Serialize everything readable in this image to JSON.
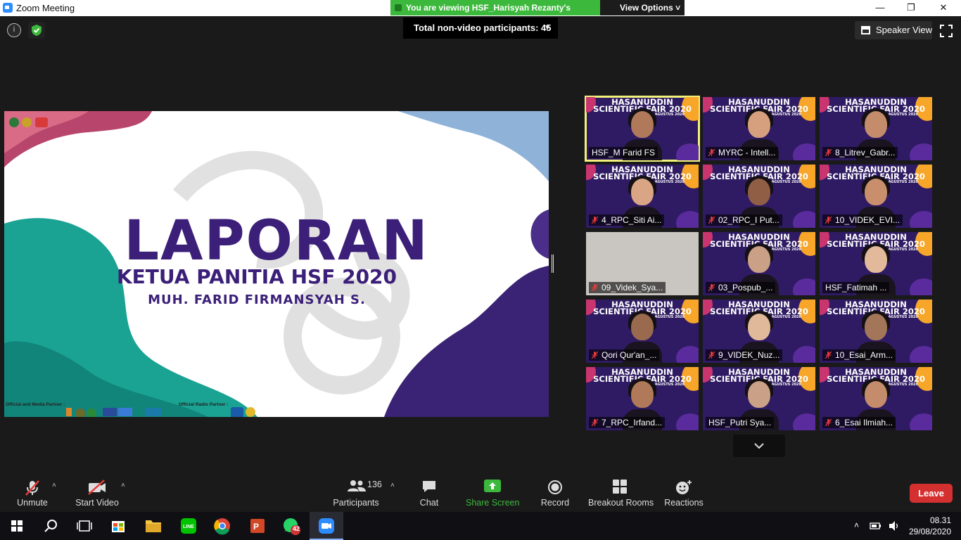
{
  "window": {
    "title": "Zoom Meeting",
    "minimize": "—",
    "maximize": "❒",
    "close": "✕"
  },
  "banner": {
    "viewing_text": "You are viewing HSF_Harisyah Rezanty's screen",
    "view_options": "View Options ˅"
  },
  "header": {
    "info_icon": "i",
    "nonvideo_participants": "Total non-video participants: 45",
    "nonvideo_chevron": "˅",
    "speaker_view": "Speaker View"
  },
  "slide": {
    "title": "LAPORAN",
    "subtitle": "KETUA PANITIA HSF 2020",
    "name": "MUH. FARID FIRMANSYAH S.",
    "media_partner_label": "Official and Media Partner :",
    "radio_partner_label": "Official Radio Partner :"
  },
  "tile_banner": {
    "line1": "HASANUDDIN",
    "line2": "SCIENTIFIC FAIR 2020",
    "date": "29 AGUSTUS 2020"
  },
  "participants": [
    {
      "name": "HSF_M Farid FS",
      "muted": false,
      "active": true
    },
    {
      "name": "MYRC - Intell...",
      "muted": true,
      "active": false
    },
    {
      "name": "8_Litrev_Gabr...",
      "muted": true,
      "active": false
    },
    {
      "name": "4_RPC_Siti Ai...",
      "muted": true,
      "active": false
    },
    {
      "name": "02_RPC_I Put...",
      "muted": true,
      "active": false
    },
    {
      "name": "10_VIDEK_EVI...",
      "muted": true,
      "active": false
    },
    {
      "name": "09_Videk_Sya...",
      "muted": true,
      "active": false
    },
    {
      "name": "03_Pospub_...",
      "muted": true,
      "active": false
    },
    {
      "name": "HSF_Fatimah ...",
      "muted": false,
      "active": false
    },
    {
      "name": "Qori Qur'an_...",
      "muted": true,
      "active": false
    },
    {
      "name": "9_VIDEK_Nuz...",
      "muted": true,
      "active": false
    },
    {
      "name": "10_Esai_Arm...",
      "muted": true,
      "active": false
    },
    {
      "name": "7_RPC_Irfand...",
      "muted": true,
      "active": false
    },
    {
      "name": "HSF_Putri Sya...",
      "muted": false,
      "active": false
    },
    {
      "name": "6_Esai Ilmiah...",
      "muted": true,
      "active": false
    }
  ],
  "toolbar": {
    "unmute": "Unmute",
    "start_video": "Start Video",
    "participants_count": "136",
    "participants": "Participants",
    "chat": "Chat",
    "share_screen": "Share Screen",
    "record": "Record",
    "breakout_rooms": "Breakout Rooms",
    "reactions": "Reactions",
    "leave": "Leave",
    "caret": "˄"
  },
  "taskbar": {
    "time": "08.31",
    "date": "29/08/2020",
    "whatsapp_badge": "42",
    "line_label": "LINE"
  },
  "colors": {
    "accent_green": "#3cb93c",
    "leave_red": "#d3302f",
    "slide_purple": "#3b1f78",
    "active_speaker": "#f2f27a"
  }
}
